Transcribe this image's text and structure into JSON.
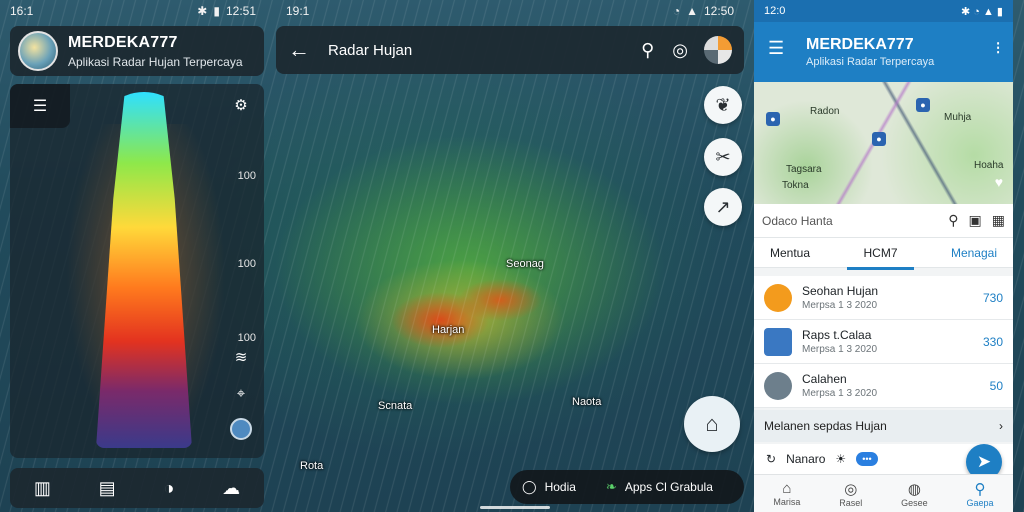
{
  "left": {
    "status": {
      "time": "16:1",
      "right": "12:51"
    },
    "app_title": "MERDEKA777",
    "app_subtitle": "Aplikasi Radar Hujan Terpercaya",
    "legend_values": [
      "100",
      "100",
      "100"
    ]
  },
  "center": {
    "status": {
      "time": "19:1",
      "right": "12:50"
    },
    "title": "Radar Hujan",
    "map_labels": [
      "Seonag",
      "Harjan",
      "Scnata",
      "Naota",
      "Rota"
    ],
    "bottom_links": [
      "Hodia",
      "Apps Cl Grabula"
    ]
  },
  "right": {
    "status": {
      "time": "12:0"
    },
    "app_title": "MERDEKA777",
    "app_subtitle": "Aplikasi Radar Terpercaya",
    "map_labels": [
      "Radon",
      "Muhja",
      "Hoaha",
      "Tagsara",
      "Tokna"
    ],
    "search_placeholder": "Odaco Hanta",
    "tabs": [
      "Mentua",
      "HCM7",
      "Menagai"
    ],
    "items": [
      {
        "name": "Seohan Hujan",
        "sub": "Merpsa 1 3 2020",
        "value": "730",
        "color": "#f39b1d"
      },
      {
        "name": "Raps t.Calaa",
        "sub": "Merpsa 1 3 2020",
        "value": "330",
        "color": "#3a78c2"
      },
      {
        "name": "Calahen",
        "sub": "Merpsa 1 3 2020",
        "value": "50",
        "color": "#6d7f8c"
      }
    ],
    "section_title": "Melanen sepdas Hujan",
    "row_text": "Nanaro",
    "nav": [
      "Marisa",
      "Rasel",
      "Gesee",
      "Gaepa"
    ]
  }
}
